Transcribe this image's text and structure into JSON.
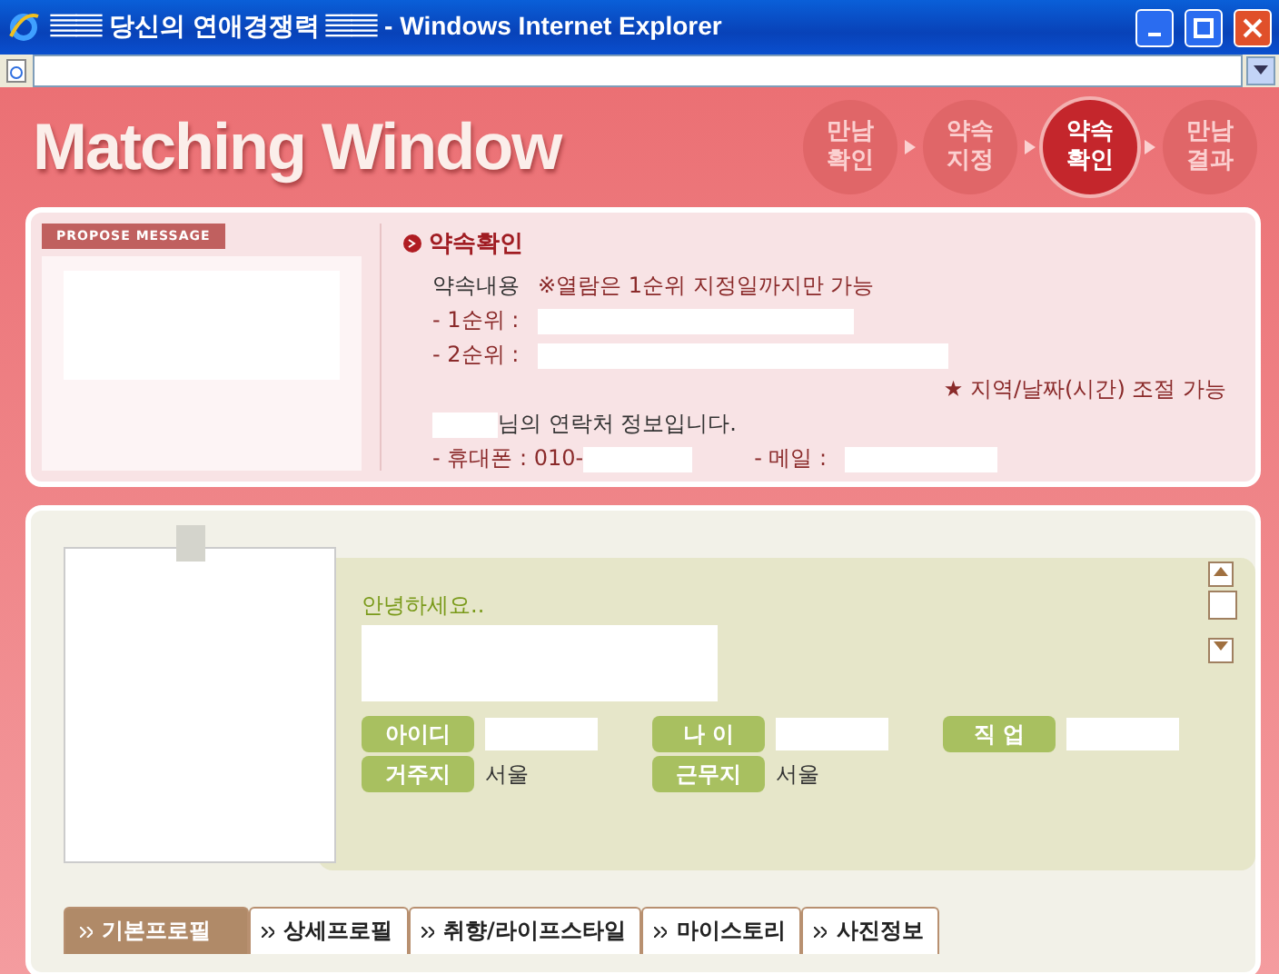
{
  "window": {
    "title": "▤▤ 당신의 연애경쟁력 ▤▤ - Windows Internet Explorer"
  },
  "header": {
    "title": "Matching Window",
    "steps": [
      {
        "label": "만남\n확인",
        "selected": false
      },
      {
        "label": "약속\n지정",
        "selected": false
      },
      {
        "label": "약속\n확인",
        "selected": true
      },
      {
        "label": "만남\n결과",
        "selected": false
      }
    ]
  },
  "message": {
    "tag": "PROPOSE MESSAGE"
  },
  "appointment": {
    "heading": "약속확인",
    "content_label": "약속내용",
    "content_note": "※열람은 1순위 지정일까지만 가능",
    "first_label": "- 1순위 :",
    "second_label": "- 2순위 :",
    "adjust_note": "★ 지역/날짜(시간) 조절 가능",
    "contact_suffix": "님의 연락처 정보입니다.",
    "phone_label": "- 휴대폰 : 010-",
    "email_label": "- 메일 :"
  },
  "profile": {
    "greeting": "안녕하세요..",
    "fields": [
      {
        "label": "아이디"
      },
      {
        "label": "나 이"
      },
      {
        "label": "직 업"
      },
      {
        "label": "거주지",
        "value": "서울"
      },
      {
        "label": "근무지",
        "value": "서울"
      }
    ]
  },
  "tabs": [
    {
      "label": "기본프로필",
      "selected": true
    },
    {
      "label": "상세프로필",
      "selected": false
    },
    {
      "label": "취향/라이프스타일",
      "selected": false
    },
    {
      "label": "마이스토리",
      "selected": false
    },
    {
      "label": "사진정보",
      "selected": false
    }
  ]
}
